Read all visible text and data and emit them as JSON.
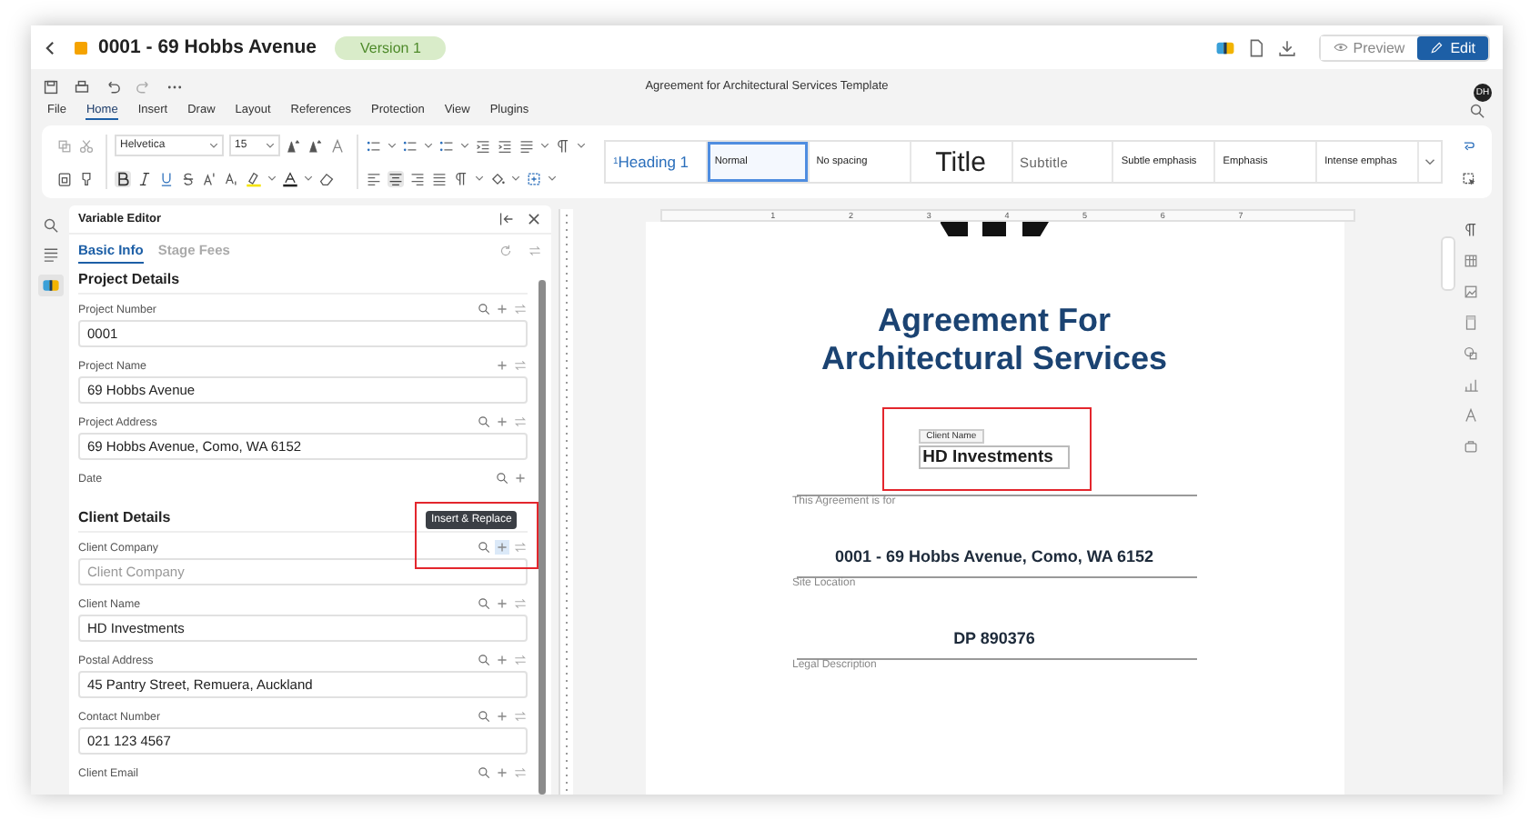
{
  "header": {
    "title": "0001 - 69 Hobbs Avenue",
    "badge": "Version 1",
    "buttons": [
      {
        "label": "Preview",
        "selected": false
      },
      {
        "label": "Edit",
        "selected": true
      }
    ]
  },
  "document_title": "Agreement for Architectural Services Template",
  "avatar": "DH",
  "menu": [
    {
      "label": "File",
      "selected": false
    },
    {
      "label": "Home",
      "selected": true
    },
    {
      "label": "Insert",
      "selected": false
    },
    {
      "label": "Draw",
      "selected": false
    },
    {
      "label": "Layout",
      "selected": false
    },
    {
      "label": "References",
      "selected": false
    },
    {
      "label": "Protection",
      "selected": false
    },
    {
      "label": "View",
      "selected": false
    },
    {
      "label": "Plugins",
      "selected": false
    }
  ],
  "ribbon": {
    "font": "Helvetica",
    "size": "15",
    "styles": [
      {
        "label": "Heading 1",
        "prefix": "1",
        "kind": "heading",
        "selected": false
      },
      {
        "label": "Normal",
        "kind": "normal",
        "selected": true
      },
      {
        "label": "No spacing",
        "kind": "normal",
        "selected": false
      },
      {
        "label": "Title",
        "kind": "title",
        "selected": false
      },
      {
        "label": "Subtitle",
        "kind": "subtitle",
        "selected": false
      },
      {
        "label": "Subtle emphasis",
        "kind": "normal",
        "selected": false
      },
      {
        "label": "Emphasis",
        "kind": "normal",
        "selected": false
      },
      {
        "label": "Intense emphas",
        "kind": "normal",
        "selected": false
      }
    ]
  },
  "variable_editor": {
    "title": "Variable Editor",
    "tabs": [
      {
        "label": "Basic Info",
        "selected": true
      },
      {
        "label": "Stage Fees",
        "selected": false
      }
    ],
    "sections": [
      {
        "title": "Project Details",
        "fields": [
          {
            "label": "Project Number",
            "value": "0001",
            "tools": [
              {
                "kind": "search",
                "selected": false
              },
              {
                "kind": "insert",
                "selected": false
              },
              {
                "kind": "replace",
                "selected": false
              }
            ]
          },
          {
            "label": "Project Name",
            "value": "69 Hobbs Avenue",
            "tools": [
              {
                "kind": "insert",
                "selected": false
              },
              {
                "kind": "replace",
                "selected": false
              }
            ]
          },
          {
            "label": "Project Address",
            "value": "69 Hobbs Avenue, Como, WA 6152",
            "tools": [
              {
                "kind": "search",
                "selected": false
              },
              {
                "kind": "insert",
                "selected": false
              },
              {
                "kind": "replace",
                "selected": false
              }
            ]
          },
          {
            "label": "Date",
            "tools": [
              {
                "kind": "search",
                "selected": false
              },
              {
                "kind": "insert",
                "selected": false
              }
            ]
          }
        ]
      },
      {
        "title": "Client Details",
        "tooltip": "Insert & Replace",
        "fields": [
          {
            "label": "Client Company",
            "placeholder": "Client Company",
            "tools": [
              {
                "kind": "search",
                "selected": false
              },
              {
                "kind": "insert",
                "selected": true
              },
              {
                "kind": "replace",
                "selected": false
              }
            ]
          },
          {
            "label": "Client Name",
            "value": "HD Investments",
            "tools": [
              {
                "kind": "search",
                "selected": false
              },
              {
                "kind": "insert",
                "selected": false
              },
              {
                "kind": "replace",
                "selected": false
              }
            ]
          },
          {
            "label": "Postal Address",
            "value": "45 Pantry Street, Remuera, Auckland",
            "tools": [
              {
                "kind": "search",
                "selected": false
              },
              {
                "kind": "insert",
                "selected": false
              },
              {
                "kind": "replace",
                "selected": false
              }
            ]
          },
          {
            "label": "Contact Number",
            "value": "021 123 4567",
            "tools": [
              {
                "kind": "search",
                "selected": false
              },
              {
                "kind": "insert",
                "selected": false
              },
              {
                "kind": "replace",
                "selected": false
              }
            ]
          },
          {
            "label": "Client Email",
            "tools": [
              {
                "kind": "search",
                "selected": false
              },
              {
                "kind": "insert",
                "selected": false
              },
              {
                "kind": "replace",
                "selected": false
              }
            ]
          }
        ]
      }
    ]
  },
  "ruler_labels": [
    "1",
    "2",
    "3",
    "4",
    "5",
    "6",
    "7"
  ],
  "page": {
    "heading": "Agreement For Architectural Services",
    "client_tag": "Client Name",
    "client_value": "HD Investments",
    "lines": [
      {
        "label": "This Agreement is for"
      },
      {
        "value": "0001 - 69 Hobbs Avenue, Como, WA 6152",
        "label": "Site Location"
      },
      {
        "value": "DP 890376",
        "label": "Legal Description"
      }
    ]
  }
}
